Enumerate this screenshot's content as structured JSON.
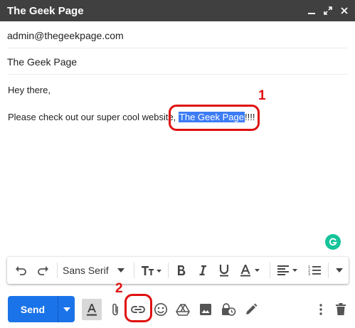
{
  "window": {
    "title": "The Geek Page",
    "controls": [
      "minimize-icon",
      "expand-icon",
      "close-icon"
    ]
  },
  "compose": {
    "to": "admin@thegeekpage.com",
    "subject": "The Geek Page",
    "greeting": "Hey there,",
    "line_before": "Please check out our super cool website, ",
    "selected_text": "The Geek Page",
    "line_after": "!!!!"
  },
  "annotations": {
    "one": "1",
    "two": "2",
    "color": "#e01010"
  },
  "formatting": {
    "font_family": "Sans Serif",
    "icons": [
      "undo-icon",
      "redo-icon",
      "font-size-icon",
      "bold-icon",
      "italic-icon",
      "underline-icon",
      "text-color-icon",
      "align-icon",
      "numbered-list-icon",
      "more-formatting-icon"
    ]
  },
  "toolbar": {
    "send_label": "Send",
    "icons": [
      "formatting-options-icon",
      "attach-icon",
      "insert-link-icon",
      "emoji-icon",
      "drive-icon",
      "photo-icon",
      "confidential-mode-icon",
      "signature-icon",
      "more-options-icon",
      "discard-icon"
    ]
  },
  "colors": {
    "titlebar": "#404040",
    "send": "#1a73e8",
    "selection": "#3c7cf5",
    "grammarly": "#15c39a"
  }
}
